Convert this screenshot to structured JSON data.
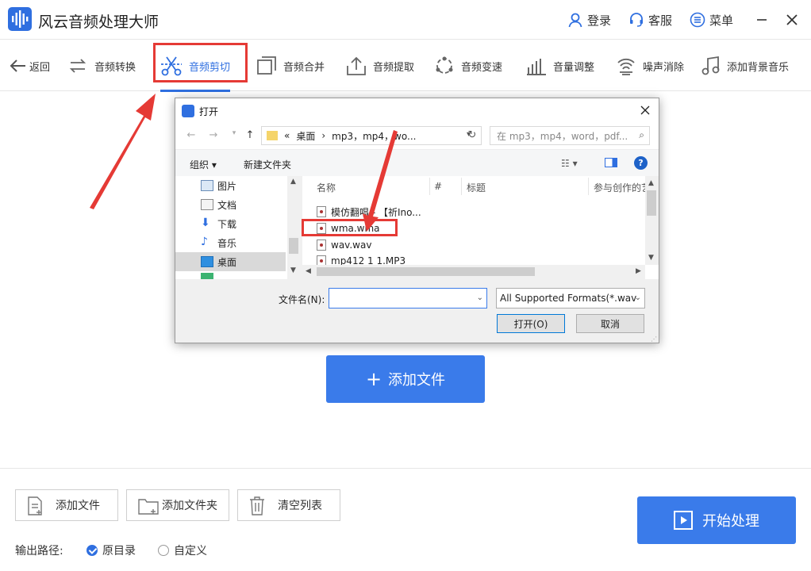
{
  "app": {
    "title": "风云音频处理大师"
  },
  "titlebar": {
    "login": "登录",
    "service": "客服",
    "menu": "菜单"
  },
  "toolbar": {
    "back": "返回",
    "tools": [
      "音频转换",
      "音频剪切",
      "音频合并",
      "音频提取",
      "音频变速",
      "音量调整",
      "噪声消除",
      "添加背景音乐"
    ]
  },
  "main": {
    "add_file": "添加文件"
  },
  "bottom": {
    "add_file": "添加文件",
    "add_folder": "添加文件夹",
    "clear_list": "清空列表",
    "start": "开始处理",
    "output_label": "输出路径:",
    "opt_original": "原目录",
    "opt_custom": "自定义"
  },
  "dialog": {
    "title": "打开",
    "path": [
      "«",
      "桌面",
      "›",
      "mp3，mp4，wo..."
    ],
    "search_placeholder": "在 mp3，mp4，word，pdf...",
    "organize": "组织 ▾",
    "new_folder": "新建文件夹",
    "left_items": [
      "图片",
      "文档",
      "下载",
      "音乐",
      "桌面"
    ],
    "columns": [
      "名称",
      "#",
      "标题",
      "参与创作的艺"
    ],
    "files": [
      "模仿翻唱 - 【祈Ino...",
      "wma.wma",
      "wav.wav",
      "mp412 1 1.MP3"
    ],
    "filename_label": "文件名(N):",
    "filetype": "All Supported Formats(*.wav",
    "open": "打开(O)",
    "cancel": "取消"
  },
  "colors": {
    "accent": "#3a7bea",
    "highlight": "#e53a35"
  }
}
